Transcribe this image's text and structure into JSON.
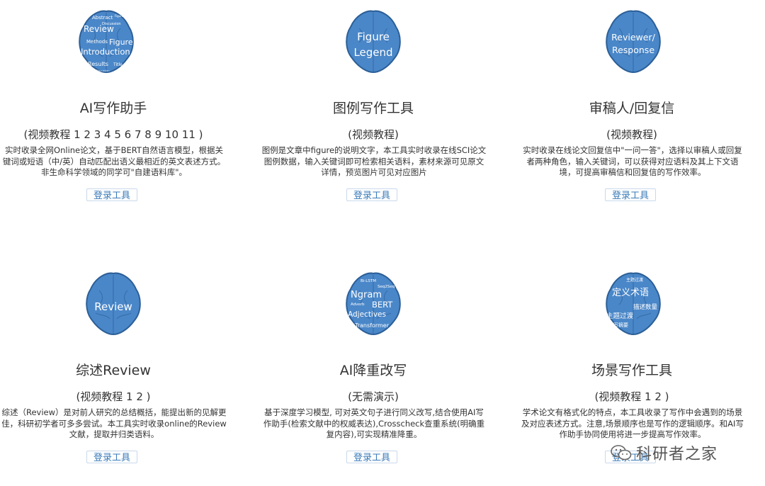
{
  "colors": {
    "brain_fill": "#4a87c9",
    "brain_stroke": "#2c5f97",
    "button_text": "#3a7ab8"
  },
  "tools": [
    {
      "title": "AI写作助手",
      "video": "(视频教程 1 2 3 4 5 6 7 8 9 10 11 )",
      "desc": "实时收录全网Online论文，基于BERT自然语言模型，根据关键词或短语（中/英）自动匹配出语义最相近的英文表述方式。非生命科学领域的同学可\"自建语料库\"。",
      "button": "登录工具",
      "brain_words": [
        "Abstract",
        "Figure",
        "Title",
        "Discussion",
        "Review",
        "Methods",
        "Figure",
        "Introduction",
        "Results",
        "Title"
      ],
      "icon": "brain-wordcloud-icon"
    },
    {
      "title": "图例写作工具",
      "video": "(视频教程)",
      "desc": "图例是文章中figure的说明文字，本工具实时收录在线SCI论文图例数据，输入关键词即可检索相关语料，素材来源可见原文详情，预览图片可见对应图片",
      "button": "登录工具",
      "brain_words": [
        "Figure",
        "Legend"
      ],
      "icon": "brain-figure-legend-icon"
    },
    {
      "title": "审稿人/回复信",
      "video": "(视频教程)",
      "desc": "实时收录在线论文回复信中\"一问一答\"，选择以审稿人或回复者两种角色，输入关键词，可以获得对应语料及其上下文语境，可提高审稿信和回复信的写作效率。",
      "button": "登录工具",
      "brain_words": [
        "Reviewer/",
        "Response"
      ],
      "icon": "brain-reviewer-icon"
    },
    {
      "title": "综述Review",
      "video": "(视频教程 1 2 )",
      "desc": "综述（Review）是对前人研究的总结概括，能提出新的见解更佳，科研初学者可多多尝试。本工具实时收录online的Review文献，提取并归类语料。",
      "button": "登录工具",
      "brain_words": [
        "Review"
      ],
      "icon": "brain-review-icon"
    },
    {
      "title": "AI降重改写",
      "video": "(无需演示)",
      "desc": "基于深度学习模型, 可对英文句子进行同义改写,结合使用AI写作助手(检索文献中的权威表达),Crosscheck查重系统(明确重复内容),可实现精准降重。",
      "button": "登录工具",
      "brain_words": [
        "Bi-LSTM",
        "Seq2Seq",
        "Ngram",
        "Adverb",
        "BERT",
        "Adjectives",
        "Transformer"
      ],
      "icon": "brain-nlp-icon"
    },
    {
      "title": "场景写作工具",
      "video": "(视频教程 1 2 )",
      "desc": "学术论文有格式化的特点，本工具收录了写作中会遇到的场景及对应表述方式。注意,场景顺序也是写作的逻辑顺序。和AI写作助手协同使用将进一步提高写作效率。",
      "button": "登录工具",
      "brain_words": [
        "主题过渡",
        "定义术语",
        "描述数量",
        "主题过渡",
        "写摘要"
      ],
      "icon": "brain-scene-icon"
    }
  ],
  "watermark": {
    "text": "科研者之家",
    "icon": "wechat-icon"
  }
}
